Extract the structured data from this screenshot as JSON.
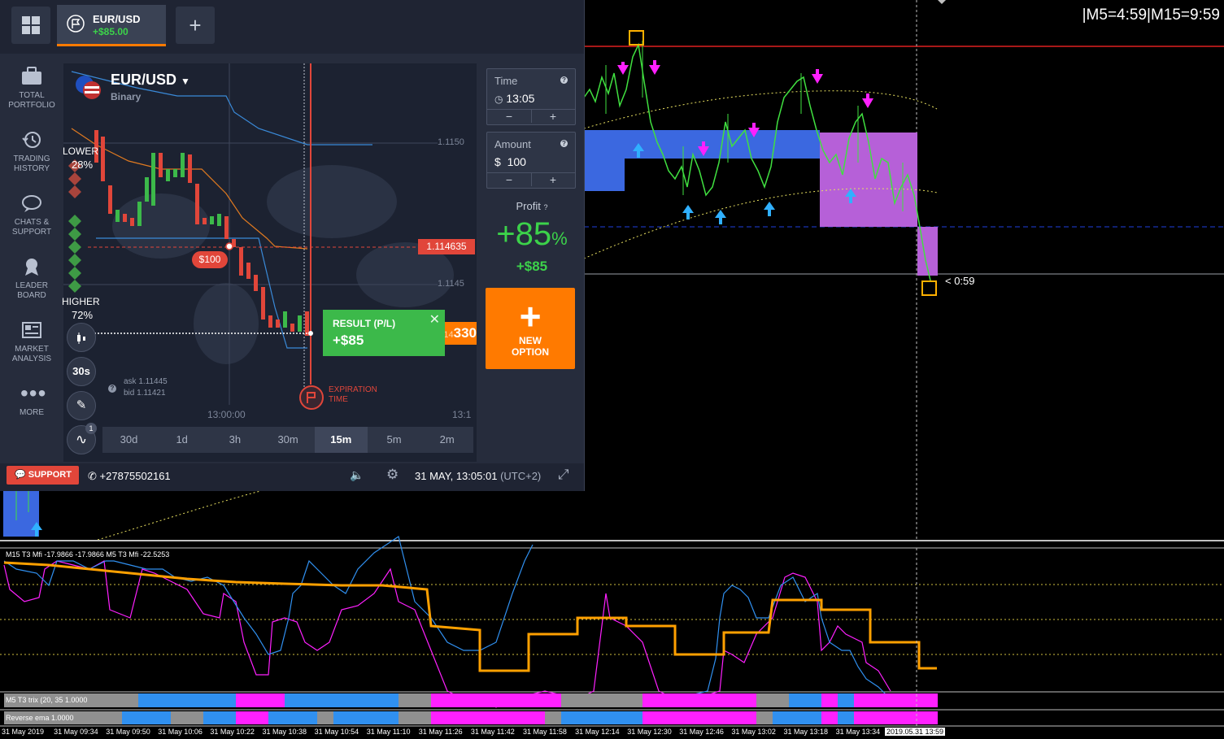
{
  "app": {
    "asset_tab": {
      "name": "EUR/USD",
      "pl": "+$85.00"
    },
    "sidebar": [
      {
        "label1": "TOTAL",
        "label2": "PORTFOLIO",
        "icon": "briefcase-icon"
      },
      {
        "label1": "TRADING",
        "label2": "HISTORY",
        "icon": "history-icon"
      },
      {
        "label1": "CHATS &",
        "label2": "SUPPORT",
        "icon": "chat-icon"
      },
      {
        "label1": "LEADER",
        "label2": "BOARD",
        "icon": "trophy-icon"
      },
      {
        "label1": "MARKET",
        "label2": "ANALYSIS",
        "icon": "news-icon"
      },
      {
        "label1": "MORE",
        "label2": "",
        "icon": "more-icon"
      }
    ],
    "chart": {
      "asset": "EUR/USD",
      "asset_type": "Binary",
      "lower_label": "LOWER",
      "lower_pct": "28%",
      "higher_label": "HIGHER",
      "higher_pct": "72%",
      "price_1": "1.1150",
      "price_2": "1.1145",
      "price_3": "1.114",
      "current_price_tag": "1.114635",
      "live_price_suffix": "330",
      "investment_badge": "$100",
      "result_label": "RESULT (P/L)",
      "result_value": "+$85",
      "ask": "ask 1.11445",
      "bid": "bid 1.11421",
      "expiration_label_1": "EXPIRATION",
      "expiration_label_2": "TIME",
      "time_tick_1": "13:00:00",
      "time_tick_2": "13:1",
      "interval_btn": "30s",
      "indicator_badge": "1"
    },
    "timeframes": [
      "30d",
      "1d",
      "3h",
      "30m",
      "15m",
      "5m",
      "2m"
    ],
    "active_timeframe": "15m",
    "time_field": {
      "label": "Time",
      "value": "13:05",
      "minus": "−",
      "plus": "+"
    },
    "amount_field": {
      "label": "Amount",
      "value": "$  100",
      "minus": "−",
      "plus": "+"
    },
    "profit": {
      "label": "Profit",
      "pct": "+85",
      "pct_sign": "%",
      "value": "+$85"
    },
    "new_option": {
      "line1": "NEW",
      "line2": "OPTION"
    },
    "bottom": {
      "support": "SUPPORT",
      "phone": "+27875502161",
      "datetime": "31 MAY, 13:05:01",
      "timezone": "(UTC+2)"
    },
    "colors": {
      "accent": "#ff7a00",
      "green": "#3cb94a",
      "red": "#e1463a",
      "panel": "#262c3c"
    }
  },
  "mt": {
    "timer": "|M5=4:59|M15=9:59",
    "countdown": "< 0:59",
    "indicator_header": "M15  T3 Mfi  -17.9866 -17.9866  M5  T3 Mfi  -22.5253",
    "trix_label": "M5 T3 trix (20, 35 1.0000",
    "ema_label": "Reverse ema 1.0000",
    "time_axis": [
      "31 May 2019",
      "31 May 09:34",
      "31 May 09:50",
      "31 May 10:06",
      "31 May 10:22",
      "31 May 10:38",
      "31 May 10:54",
      "31 May 11:10",
      "31 May 11:26",
      "31 May 11:42",
      "31 May 11:58",
      "31 May 12:14",
      "31 May 12:30",
      "31 May 12:46",
      "31 May 13:02",
      "31 May 13:18",
      "31 May 13:34"
    ],
    "time_axis_current": "2019.05.31 13:59"
  }
}
